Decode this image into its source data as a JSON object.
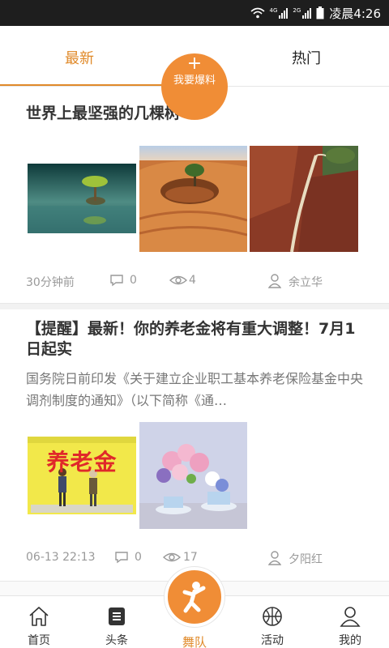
{
  "status_bar": {
    "net1": "4G",
    "net2": "2G",
    "time": "凌晨4:26"
  },
  "tabs": {
    "latest": "最新",
    "hot": "热门",
    "tip_label": "我要爆料",
    "tip_plus": "+"
  },
  "articles": [
    {
      "title": "世界上最坚强的几棵树",
      "time": "30分钟前",
      "comments": "0",
      "views": "4",
      "author": "余立华"
    },
    {
      "title": "【提醒】最新！你的养老金将有重大调整！7月1日起实",
      "summary": "国务院日前印发《关于建立企业职工基本养老保险基金中央调剂制度的通知》（以下简称《通…",
      "image_text": "养老金",
      "time": "06-13 22:13",
      "comments": "0",
      "views": "17",
      "author": "夕阳红"
    }
  ],
  "bottom_nav": [
    {
      "label": "首页",
      "icon": "home-icon"
    },
    {
      "label": "头条",
      "icon": "headline-icon"
    },
    {
      "label": "舞队",
      "icon": "dancer-icon"
    },
    {
      "label": "活动",
      "icon": "basketball-icon"
    },
    {
      "label": "我的",
      "icon": "user-icon"
    }
  ],
  "colors": {
    "accent": "#f08d36",
    "accent_text": "#e08a2a",
    "status_bar": "#1e1e1e"
  }
}
